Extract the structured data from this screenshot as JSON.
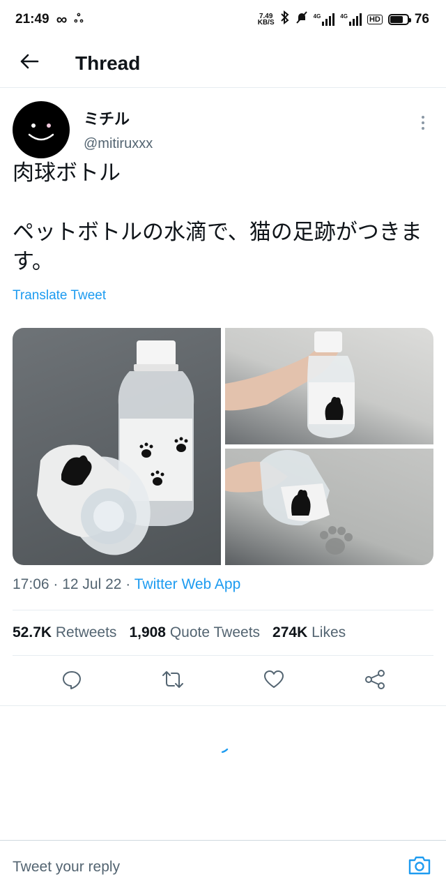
{
  "status_bar": {
    "time": "21:49",
    "net_speed_value": "7.49",
    "net_speed_unit": "KB/S",
    "signal_1_label": "4G",
    "signal_2_label": "4G",
    "hd_label": "HD",
    "battery": "76"
  },
  "header": {
    "title": "Thread"
  },
  "tweet": {
    "display_name": "ミチル",
    "handle": "@mitiruxxx",
    "text": "肉球ボトル\n\nペットボトルの水滴で、猫の足跡がつきます。",
    "translate_label": "Translate Tweet",
    "time": "17:06",
    "date": "12 Jul 22",
    "source": "Twitter Web App"
  },
  "stats": {
    "retweets_count": "52.7K",
    "retweets_label": "Retweets",
    "quotes_count": "1,908",
    "quotes_label": "Quote Tweets",
    "likes_count": "274K",
    "likes_label": "Likes"
  },
  "reply": {
    "placeholder": "Tweet your reply"
  },
  "colors": {
    "accent": "#1d9bf0",
    "text": "#0f1419",
    "secondary": "#536471",
    "border": "#e6ecf0"
  },
  "icons": {
    "back": "arrow-left-icon",
    "more": "more-vertical-icon",
    "reply": "reply-icon",
    "retweet": "retweet-icon",
    "like": "heart-icon",
    "share": "share-icon",
    "camera": "camera-icon"
  }
}
